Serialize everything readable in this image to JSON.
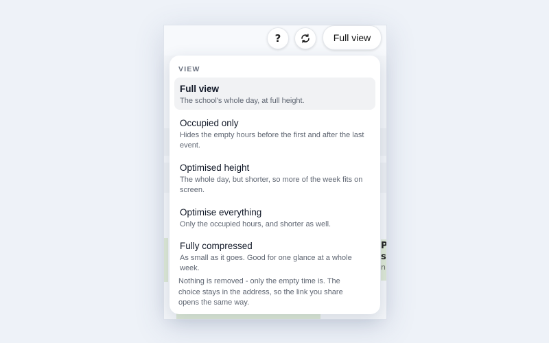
{
  "toolbar": {
    "help_label": "?",
    "refresh_icon": "refresh-icon",
    "view_button_label": "Full view"
  },
  "menu": {
    "heading": "VIEW",
    "items": [
      {
        "label": "Full view",
        "description": "The school's whole day, at full height.",
        "selected": true
      },
      {
        "label": "Occupied only",
        "description": "Hides the empty hours before the first and after the last event.",
        "selected": false
      },
      {
        "label": "Optimised height",
        "description": "The whole day, but shorter, so more of the week fits on screen.",
        "selected": false
      },
      {
        "label": "Optimise everything",
        "description": "Only the occupied hours, and shorter as well.",
        "selected": false
      },
      {
        "label": "Fully compressed",
        "description": "As small as it goes. Good for one glance at a whole week.",
        "selected": false
      }
    ],
    "footnote": "Nothing is removed - only the empty time is. The choice stays in the address, so the link you share opens the same way."
  },
  "background": {
    "partial_text_1": "P",
    "partial_text_2": "s",
    "partial_text_3": "n"
  },
  "colors": {
    "page_bg": "#eef2f8",
    "menu_bg": "#ffffff",
    "selected_bg": "#f1f2f4",
    "muted_text": "#5f6672"
  }
}
